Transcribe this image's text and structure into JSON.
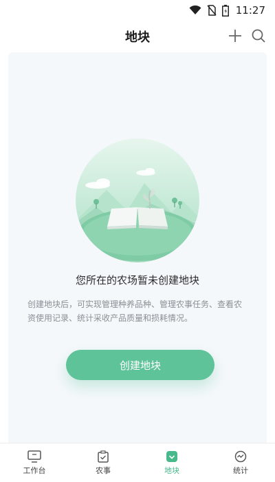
{
  "status_bar": {
    "time": "11:27",
    "icons": [
      "wifi-icon",
      "no-sim-icon",
      "battery-icon"
    ]
  },
  "header": {
    "title": "地块",
    "actions": [
      "add-icon",
      "search-icon"
    ]
  },
  "empty_state": {
    "title": "您所在的农场暂未创建地块",
    "description": "创建地块后，可实现管理种养品种、管理农事任务、查看农资使用记录、统计采收产品质量和损耗情况。",
    "button_label": "创建地块"
  },
  "tab_bar": {
    "tabs": [
      {
        "label": "工作台",
        "icon": "monitor-icon"
      },
      {
        "label": "农事",
        "icon": "clipboard-icon"
      },
      {
        "label": "地块",
        "icon": "plot-icon"
      },
      {
        "label": "统计",
        "icon": "stats-icon"
      }
    ],
    "active_index": 2
  },
  "colors": {
    "accent": "#5fc39a",
    "active_tab": "#47b98a",
    "content_bg": "#f5f8fb"
  }
}
